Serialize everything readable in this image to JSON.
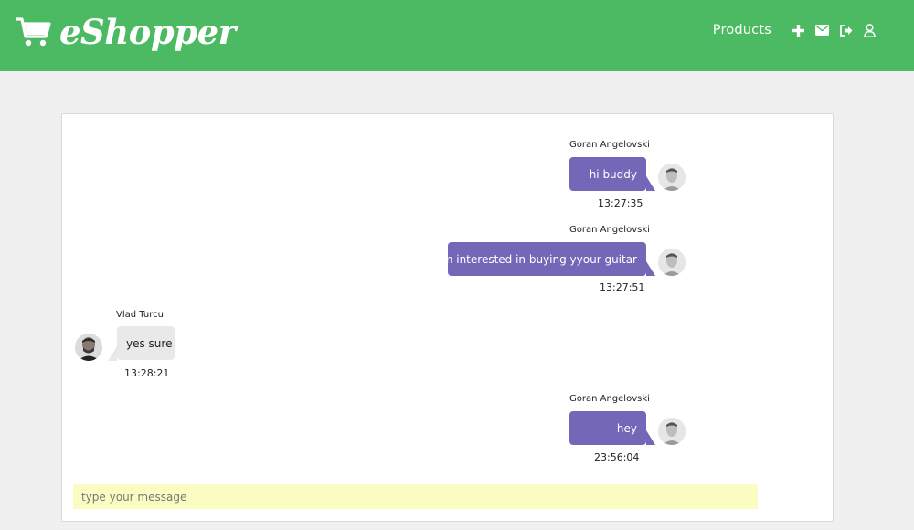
{
  "app": {
    "brand": "eShopper"
  },
  "nav": {
    "products_label": "Products",
    "icons": [
      "plus-icon",
      "envelope-icon",
      "sign-out-icon",
      "user-icon"
    ]
  },
  "chat": {
    "messages": [
      {
        "sender": "Goran Angelovski",
        "text": "hi buddy",
        "time": "13:27:35",
        "direction": "outgoing"
      },
      {
        "sender": "Goran Angelovski",
        "text": "i'm interested in buying yyour guitar",
        "time": "13:27:51",
        "direction": "outgoing"
      },
      {
        "sender": "Vlad Turcu",
        "text": "yes sure",
        "time": "13:28:21",
        "direction": "incoming"
      },
      {
        "sender": "Goran Angelovski",
        "text": "hey",
        "time": "23:56:04",
        "direction": "outgoing"
      }
    ],
    "composer_placeholder": "type your message"
  },
  "colors": {
    "navbar": "#4cb963",
    "outgoing_bubble": "#7467b8",
    "incoming_bubble": "#e9e9e9",
    "composer_bg": "#fbfcc1"
  }
}
